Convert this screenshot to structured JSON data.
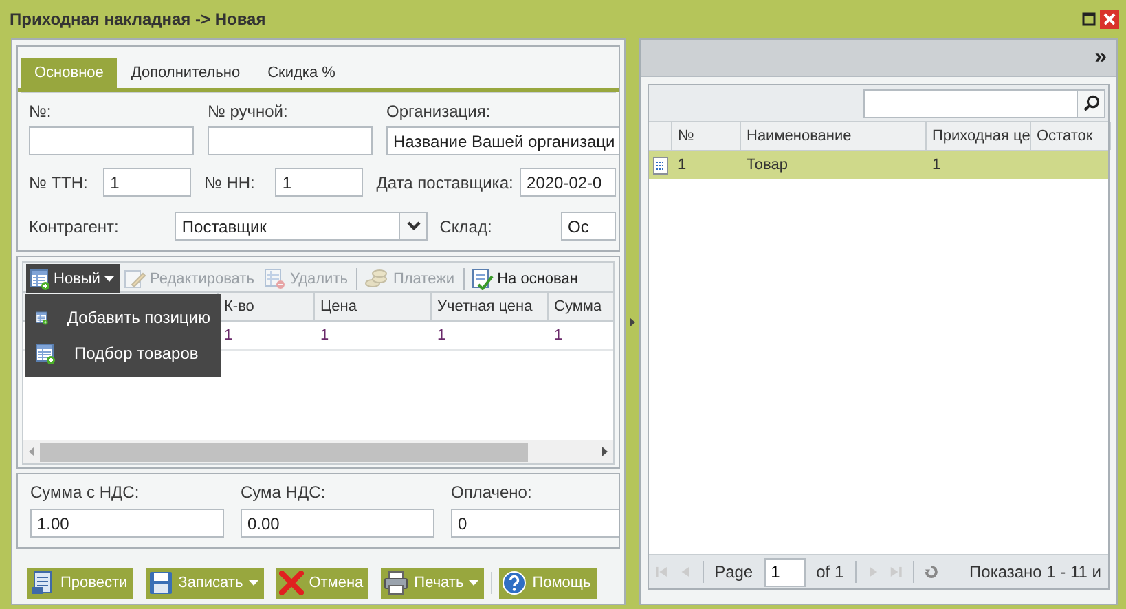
{
  "window": {
    "title": "Приходная накладная -> Новая"
  },
  "tabs": [
    {
      "label": "Основное",
      "selected": true
    },
    {
      "label": "Дополнительно",
      "selected": false
    },
    {
      "label": "Скидка %",
      "selected": false
    }
  ],
  "form": {
    "top_fields": [
      {
        "label": "№:"
      },
      {
        "label": "№ ручной:"
      },
      {
        "label": "Организация:",
        "value": "Название Вашей организаци"
      }
    ],
    "middle_fields": [
      {
        "label": "№ ТТН:",
        "value": "1"
      },
      {
        "label": "№ НН:",
        "value": "1"
      },
      {
        "label": "Дата поставщика:",
        "value": "2020-02-0"
      }
    ],
    "contragent": {
      "label": "Контрагент:",
      "value": "Поставщик"
    },
    "warehouse": {
      "label": "Склад:",
      "value": "Ос"
    }
  },
  "items_grid": {
    "toolbar": [
      {
        "label": "Новый",
        "kind": "new",
        "disabled": false,
        "open": true
      },
      {
        "label": "Редактировать",
        "kind": "edit",
        "disabled": true,
        "open": false
      },
      {
        "label": "Удалить",
        "kind": "delete",
        "disabled": true,
        "open": false
      },
      {
        "label": "Платежи",
        "kind": "payments",
        "disabled": true,
        "open": false
      },
      {
        "label": "На основан",
        "kind": "based",
        "disabled": false,
        "open": false
      }
    ],
    "menu": [
      {
        "label": "Добавить позицию"
      },
      {
        "label": "Подбор товаров"
      }
    ],
    "columns": [
      "К-во",
      "Цена",
      "Учетная цена",
      "Сумма"
    ],
    "rows": [
      [
        "1",
        "1",
        "1",
        "1"
      ]
    ]
  },
  "totals": [
    {
      "label": "Сумма с НДС:",
      "value": "1.00"
    },
    {
      "label": "Сума НДС:",
      "value": "0.00"
    },
    {
      "label": "Оплачено:",
      "value": "0"
    }
  ],
  "buttons": [
    {
      "label": "Провести",
      "kind": "post",
      "dropdown": false
    },
    {
      "label": "Записать",
      "kind": "save",
      "dropdown": true
    },
    {
      "label": "Отмена",
      "kind": "cancel",
      "dropdown": false
    },
    {
      "label": "Печать",
      "kind": "print",
      "dropdown": true
    },
    {
      "label": "Помощь",
      "kind": "help",
      "dropdown": false
    }
  ],
  "side_panel": {
    "collapse_glyph": "»",
    "columns": [
      "№",
      "Наименование",
      "Приходная це",
      "Остаток"
    ],
    "rows": [
      {
        "number": "1",
        "name": "Товар",
        "price": "1",
        "selected": true
      }
    ],
    "pager": {
      "page_label": "Page",
      "page": "1",
      "of_label": "of 1",
      "status": "Показано 1 - 11 и"
    }
  }
}
